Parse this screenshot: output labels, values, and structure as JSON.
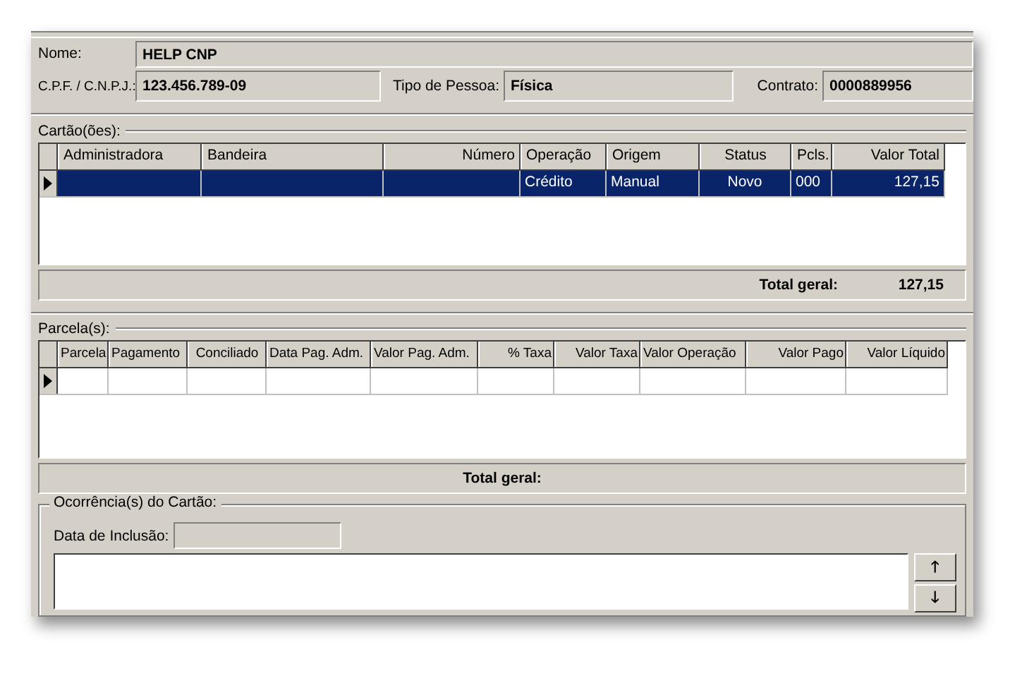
{
  "header": {
    "name_label": "Nome:",
    "name_value": "HELP CNP",
    "cpf_label": "C.P.F. / C.N.P.J.:",
    "cpf_value": "123.456.789-09",
    "tipo_label": "Tipo de Pessoa:",
    "tipo_value": "Física",
    "contrato_label": "Contrato:",
    "contrato_value": "0000889956"
  },
  "cartoes": {
    "label": "Cartão(ões):",
    "columns": [
      "Administradora",
      "Bandeira",
      "Número",
      "Operação",
      "Origem",
      "Status",
      "Pcls.",
      "Valor Total"
    ],
    "rows": [
      {
        "selected": true,
        "cells": {
          "3": "Crédito",
          "4": "Manual",
          "5": "Novo",
          "6": "000",
          "7": "127,15"
        }
      }
    ],
    "total_label": "Total geral:",
    "total_value": "127,15"
  },
  "parcelas": {
    "label": "Parcela(s):",
    "columns": [
      "Parcela",
      "Pagamento",
      "Conciliado",
      "Data Pag. Adm.",
      "Valor Pag. Adm.",
      "% Taxa",
      "Valor Taxa",
      "Valor Operação",
      "Valor Pago",
      "Valor Líquido"
    ],
    "total_label": "Total geral:"
  },
  "ocorrencias": {
    "title": "Ocorrência(s) do Cartão:",
    "data_label": "Data de Inclusão:",
    "up_button": "🡑",
    "down_button": "🡓"
  }
}
